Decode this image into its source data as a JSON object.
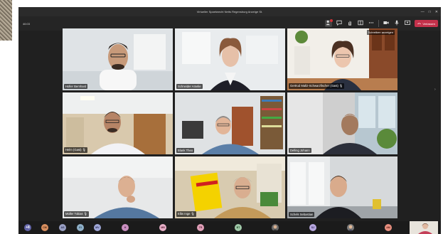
{
  "window": {
    "title": "Virtueller Spaetwecht Netts Regensburg Anzeige St.",
    "timer": "46:03",
    "controls": [
      "—",
      "□",
      "✕"
    ]
  },
  "toolbar": {
    "leave_label": "Verlassen"
  },
  "participants": [
    {
      "name": "Holler Bernhard",
      "mic": false
    },
    {
      "name": "Schneider Amelie",
      "mic": false
    },
    {
      "name": "Gertrud Maltz-Schwarzfischer (Gast)",
      "mic": true,
      "top_label": "Schreiben anzeigen"
    },
    {
      "name": "Helm (Gast)",
      "mic": true
    },
    {
      "name": "Blank Theo",
      "mic": false
    },
    {
      "name": "Delling Johann",
      "mic": false
    },
    {
      "name": "Müller Tobias",
      "mic": true
    },
    {
      "name": "Elbs Inge",
      "mic": true
    },
    {
      "name": "Schels Sebastian",
      "mic": false
    }
  ],
  "bottom_avatars": [
    {
      "initials": "+8",
      "color": "#6264a7"
    },
    {
      "initials": "CM",
      "color": "#d99060"
    },
    {
      "initials": "AS",
      "color": "#9aa0c4"
    },
    {
      "initials": "EI",
      "color": "#8fb0c8"
    },
    {
      "initials": "MV",
      "color": "#a0a8d8"
    },
    {
      "initials": "H",
      "color": "#c98fc0"
    },
    {
      "initials": "MB",
      "color": "#e8b0c8"
    },
    {
      "initials": "TR",
      "color": "#e0a0b8"
    },
    {
      "initials": "BT",
      "color": "#a0c8a8"
    },
    {
      "initials": "SJ",
      "color": "#b8a8e0"
    },
    {
      "initials": "AM",
      "color": "#e89080"
    }
  ],
  "colors": {
    "window_bg": "#202020",
    "leave_red": "#c4314b",
    "teams_purple": "#6264a7"
  }
}
